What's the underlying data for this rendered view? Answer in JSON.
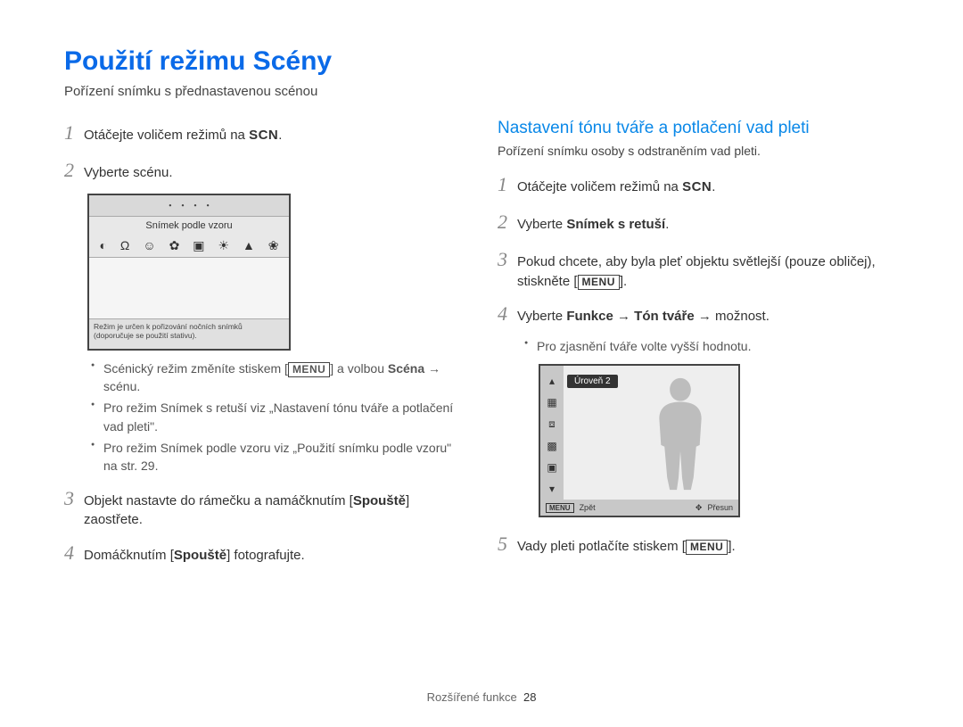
{
  "title": "Použití režimu Scény",
  "subtitle": "Pořízení snímku s přednastavenou scénou",
  "left": {
    "step1_a": "Otáčejte voličem režimů na ",
    "step1_scn": "SCN",
    "step1_b": ".",
    "step2": "Vyberte scénu.",
    "shot": {
      "title": "Snímek podle vzoru",
      "note": "Režim je určen k pořizování nočních snímků (doporučuje se použití stativu)."
    },
    "bullets": [
      {
        "a": "Scénický režim změníte stiskem [",
        "menu": "MENU",
        "b": "] a volbou ",
        "bold": "Scéna",
        "c": " → scénu."
      },
      {
        "a": "Pro režim Snímek s retuší viz „Nastavení tónu tváře a potlačení vad pleti\"."
      },
      {
        "a": "Pro režim Snímek podle vzoru viz „Použití snímku podle vzoru\" na str. 29."
      }
    ],
    "step3_a": "Objekt nastavte do rámečku a namáčknutím [",
    "step3_bold": "Spouště",
    "step3_b": "] zaostřete.",
    "step4_a": "Domáčknutím [",
    "step4_bold": "Spouště",
    "step4_b": "] fotografujte."
  },
  "right": {
    "heading": "Nastavení tónu tváře a potlačení vad pleti",
    "sub": "Pořízení snímku osoby s odstraněním vad pleti.",
    "step1_a": "Otáčejte voličem režimů na ",
    "step1_scn": "SCN",
    "step1_b": ".",
    "step2_a": "Vyberte ",
    "step2_bold": "Snímek s retuší",
    "step2_b": ".",
    "step3_a": "Pokud chcete, aby byla pleť objektu světlejší (pouze obličej), stiskněte [",
    "step3_menu": "MENU",
    "step3_b": "].",
    "step4_a": "Vyberte ",
    "step4_b1": "Funkce",
    "step4_arrow": " → ",
    "step4_b2": "Tón tváře",
    "step4_c": " → možnost.",
    "bullet": "Pro zjasnění tváře volte vyšší hodnotu.",
    "shot": {
      "badge": "Úroveň 2",
      "menu": "MENU",
      "back": "Zpět",
      "move": "Přesun"
    },
    "step5_a": "Vady pleti potlačíte stiskem [",
    "step5_menu": "MENU",
    "step5_b": "]."
  },
  "footer": {
    "section": "Rozšířené funkce",
    "page": "28"
  }
}
